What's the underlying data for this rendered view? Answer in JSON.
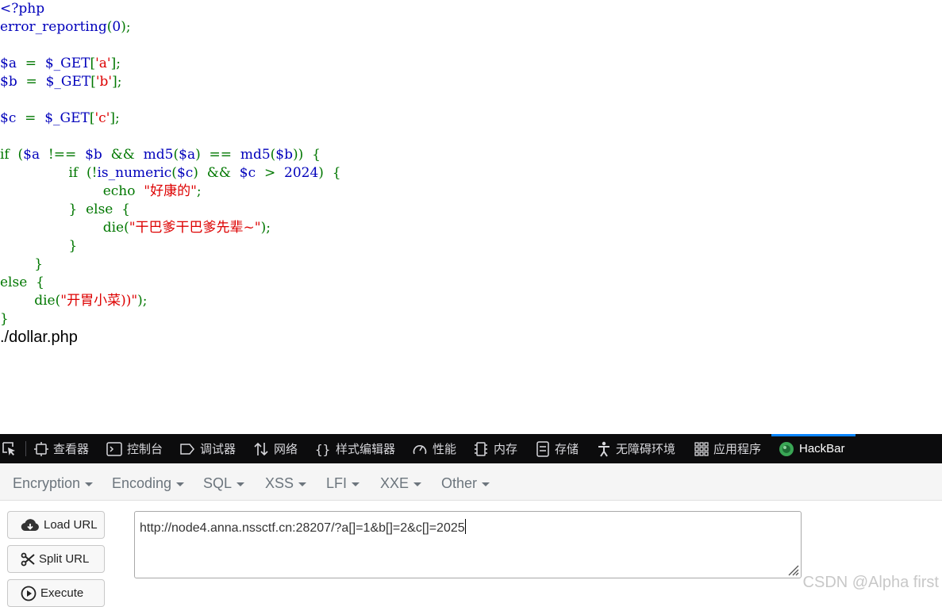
{
  "code_lines": [
    [
      {
        "c": "v",
        "t": "<?php"
      }
    ],
    [
      {
        "c": "v",
        "t": "error_reporting"
      },
      {
        "c": "k",
        "t": "("
      },
      {
        "c": "v",
        "t": "0"
      },
      {
        "c": "k",
        "t": ");"
      }
    ],
    [],
    [
      {
        "c": "v",
        "t": "$a"
      },
      {
        "c": "k",
        "t": "  =  "
      },
      {
        "c": "v",
        "t": "$_GET"
      },
      {
        "c": "k",
        "t": "["
      },
      {
        "c": "s",
        "t": "'a'"
      },
      {
        "c": "k",
        "t": "];"
      }
    ],
    [
      {
        "c": "v",
        "t": "$b"
      },
      {
        "c": "k",
        "t": "  =  "
      },
      {
        "c": "v",
        "t": "$_GET"
      },
      {
        "c": "k",
        "t": "["
      },
      {
        "c": "s",
        "t": "'b'"
      },
      {
        "c": "k",
        "t": "];"
      }
    ],
    [],
    [
      {
        "c": "v",
        "t": "$c"
      },
      {
        "c": "k",
        "t": "  =  "
      },
      {
        "c": "v",
        "t": "$_GET"
      },
      {
        "c": "k",
        "t": "["
      },
      {
        "c": "s",
        "t": "'c'"
      },
      {
        "c": "k",
        "t": "];"
      }
    ],
    [],
    [
      {
        "c": "k",
        "t": "if  ("
      },
      {
        "c": "v",
        "t": "$a"
      },
      {
        "c": "k",
        "t": "  !==  "
      },
      {
        "c": "v",
        "t": "$b"
      },
      {
        "c": "k",
        "t": "  &&  "
      },
      {
        "c": "v",
        "t": "md5"
      },
      {
        "c": "k",
        "t": "("
      },
      {
        "c": "v",
        "t": "$a"
      },
      {
        "c": "k",
        "t": ")  ==  "
      },
      {
        "c": "v",
        "t": "md5"
      },
      {
        "c": "k",
        "t": "("
      },
      {
        "c": "v",
        "t": "$b"
      },
      {
        "c": "k",
        "t": "))  {"
      }
    ],
    [
      {
        "c": "k",
        "t": "                if  (!"
      },
      {
        "c": "v",
        "t": "is_numeric"
      },
      {
        "c": "k",
        "t": "("
      },
      {
        "c": "v",
        "t": "$c"
      },
      {
        "c": "k",
        "t": ")  &&  "
      },
      {
        "c": "v",
        "t": "$c"
      },
      {
        "c": "k",
        "t": "  >  "
      },
      {
        "c": "v",
        "t": "2024"
      },
      {
        "c": "k",
        "t": ")  {"
      }
    ],
    [
      {
        "c": "k",
        "t": "                        echo  "
      },
      {
        "c": "s",
        "t": "\"好康的\""
      },
      {
        "c": "k",
        "t": ";"
      }
    ],
    [
      {
        "c": "k",
        "t": "                }  else  {"
      }
    ],
    [
      {
        "c": "k",
        "t": "                        die("
      },
      {
        "c": "s",
        "t": "\"干巴爹干巴爹先辈~\""
      },
      {
        "c": "k",
        "t": ");"
      }
    ],
    [
      {
        "c": "k",
        "t": "                }"
      }
    ],
    [
      {
        "c": "k",
        "t": "        }"
      }
    ],
    [
      {
        "c": "k",
        "t": "else  {"
      }
    ],
    [
      {
        "c": "k",
        "t": "        die("
      },
      {
        "c": "s",
        "t": "\"开胃小菜))\""
      },
      {
        "c": "k",
        "t": ");"
      }
    ],
    [
      {
        "c": "k",
        "t": "}"
      }
    ]
  ],
  "file_path": "./dollar.php",
  "devtools": {
    "tabs": [
      {
        "label": "查看器",
        "icon": "inspector-icon"
      },
      {
        "label": "控制台",
        "icon": "console-icon"
      },
      {
        "label": "调试器",
        "icon": "debugger-icon"
      },
      {
        "label": "网络",
        "icon": "network-icon"
      },
      {
        "label": "样式编辑器",
        "icon": "style-editor-icon"
      },
      {
        "label": "性能",
        "icon": "performance-icon"
      },
      {
        "label": "内存",
        "icon": "memory-icon"
      },
      {
        "label": "存储",
        "icon": "storage-icon"
      },
      {
        "label": "无障碍环境",
        "icon": "accessibility-icon"
      },
      {
        "label": "应用程序",
        "icon": "application-icon"
      },
      {
        "label": "HackBar",
        "icon": "hackbar-icon"
      }
    ],
    "active_tab": "HackBar",
    "accent": "#0a84ff"
  },
  "hackbar": {
    "menu": [
      "Encryption",
      "Encoding",
      "SQL",
      "XSS",
      "LFI",
      "XXE",
      "Other"
    ],
    "buttons": {
      "load": "Load URL",
      "split": "Split URL",
      "execute": "Execute"
    },
    "url": "http://node4.anna.nssctf.cn:28207/?a[]=1&b[]=2&c[]=2025"
  },
  "watermark": "CSDN @Alpha first"
}
